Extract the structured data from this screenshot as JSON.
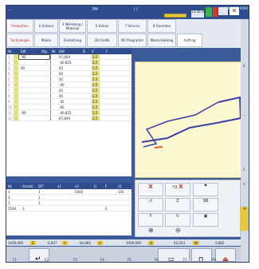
{
  "window": {
    "title": "...",
    "program_label": "PN",
    "clock": "13:30:16",
    "seg_a": "[ ]",
    "seg_b": "ICON",
    "seg_right": "0000 0000 0000",
    "w_button": "W"
  },
  "tabs_row1": [
    "Produktion",
    "E.Achsen",
    "3 Werkzeug / Material",
    "6 Extras",
    "7 Service",
    "8 Favoriten"
  ],
  "tabs_row2": [
    "Technologie",
    "Makro",
    "Einstellung",
    "3D-Grafik",
    "NC-Programm",
    "Makro-Katalog",
    "Auftrag"
  ],
  "grid": {
    "headers": [
      "Nr.",
      "EW",
      "Stg",
      "Nr.",
      "DW",
      "D",
      "V",
      "F"
    ],
    "rows": [
      {
        "num": "1",
        "ew": "-90",
        "dw": "67,849",
        "v": "2,5"
      },
      {
        "num": "2",
        "ew": "",
        "dw": "-40,825",
        "v": "2,5"
      },
      {
        "num": "3",
        "ew": "90",
        "dw": "45",
        "v": "2,5"
      },
      {
        "num": "4",
        "ew": "",
        "dw": "90",
        "v": "2,5"
      },
      {
        "num": "5",
        "ew": "",
        "dw": "45",
        "v": "2,5"
      },
      {
        "num": "6",
        "ew": "",
        "dw": "-90",
        "v": "2,5"
      },
      {
        "num": "7",
        "ew": "",
        "dw": "45",
        "v": "2,5"
      },
      {
        "num": "8",
        "ew": "",
        "dw": "90",
        "v": "2,5"
      },
      {
        "num": "9",
        "ew": "",
        "dw": "-45",
        "v": "2,5"
      },
      {
        "num": "10",
        "ew": "",
        "dw": "-90",
        "v": "2,5"
      },
      {
        "num": "11",
        "ew": "-90",
        "dw": "-40,825",
        "v": "2,5"
      },
      {
        "num": "12",
        "ew": "",
        "dw": "67,849",
        "v": "2,5"
      }
    ]
  },
  "bottom_table": {
    "headers": [
      "Nr.",
      "Anzahl",
      "DIT",
      "x1",
      "x2",
      "G",
      "F",
      "z1"
    ],
    "rows": [
      {
        "c0": "1",
        "c1": "",
        "c2": "1",
        "c3": "",
        "c4": "5000",
        "c5": "",
        "c6": "",
        "c7": "100"
      },
      {
        "c0": "2",
        "c1": "",
        "c2": "1",
        "c3": "",
        "c4": "",
        "c5": "",
        "c6": "",
        "c7": ""
      },
      {
        "c0": "3",
        "c1": "",
        "c2": "1",
        "c3": "",
        "c4": "",
        "c5": "",
        "c6": "",
        "c7": ""
      },
      {
        "c0": "5184",
        "c1": "3",
        "c2": "",
        "c3": "",
        "c4": "",
        "c5": "",
        "c6": "0",
        "c7": ""
      }
    ]
  },
  "status": {
    "v1": "1009,000",
    "z_label": "Z",
    "v2": "6,827",
    "c_label": "C",
    "v3": "84,892",
    "a_label": "A",
    "v4": "1009,000",
    "q_label": "Q",
    "v5": "63,043",
    "w_label": "W",
    "v6": "0,882"
  },
  "fkeys": [
    "F1",
    "F2",
    "F3",
    "F4",
    "F5",
    "F6",
    "F7",
    "F8"
  ],
  "ctrl": {
    "y1": "Y1",
    "x2": "X",
    "y2": "Y2",
    "x3": "X",
    "z3": "Z",
    "y3": "Y",
    "nb": "SB"
  },
  "colors": {
    "accent": "#2f4d8c",
    "highlight": "#e8c63a",
    "path": "#3a3fa8",
    "flange": "#e05a3a"
  },
  "side": {
    "ticks": [
      "2",
      "-",
      "1",
      "+"
    ],
    "tab_label": "H"
  }
}
